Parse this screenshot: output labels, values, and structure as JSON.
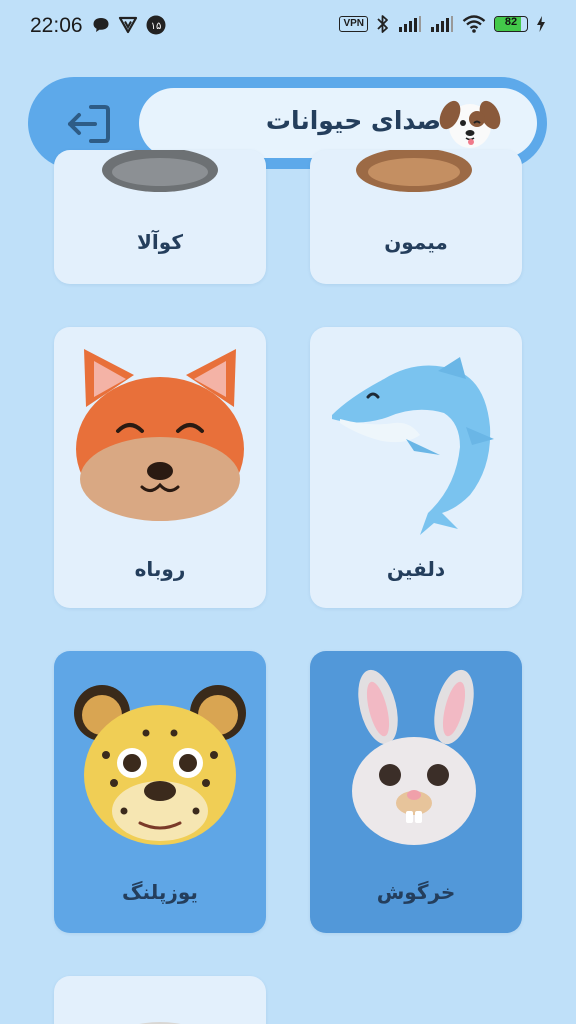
{
  "status_bar": {
    "time": "22:06",
    "left_icons": [
      "chat-bubble-icon",
      "shield-v-icon",
      "notification-count-icon"
    ],
    "notification_count": "۱۵",
    "vpn": "VPN",
    "battery_level": "82",
    "battery_fraction": 0.82
  },
  "header": {
    "title": "صدای حیوانات",
    "logout_icon": "logout-icon",
    "avatar": "puppy-avatar"
  },
  "animals": [
    {
      "label": "کوآلا",
      "image": "koala",
      "selected": false
    },
    {
      "label": "میمون",
      "image": "monkey",
      "selected": false
    },
    {
      "label": "روباه",
      "image": "fox",
      "selected": false
    },
    {
      "label": "دلفین",
      "image": "dolphin",
      "selected": false
    },
    {
      "label": "یوزپلنگ",
      "image": "cheetah",
      "selected": true
    },
    {
      "label": "خرگوش",
      "image": "rabbit",
      "selected": true
    },
    {
      "label": "",
      "image": "partially-visible-animal",
      "selected": false
    }
  ],
  "colors": {
    "background": "#bfe0f9",
    "card": "#e3f0fc",
    "card_selected": "#5fa6e6",
    "header_outer": "#5da9ea",
    "header_pill": "#e7f3fd",
    "title_text": "#243e5c",
    "battery": "#43c94a"
  }
}
